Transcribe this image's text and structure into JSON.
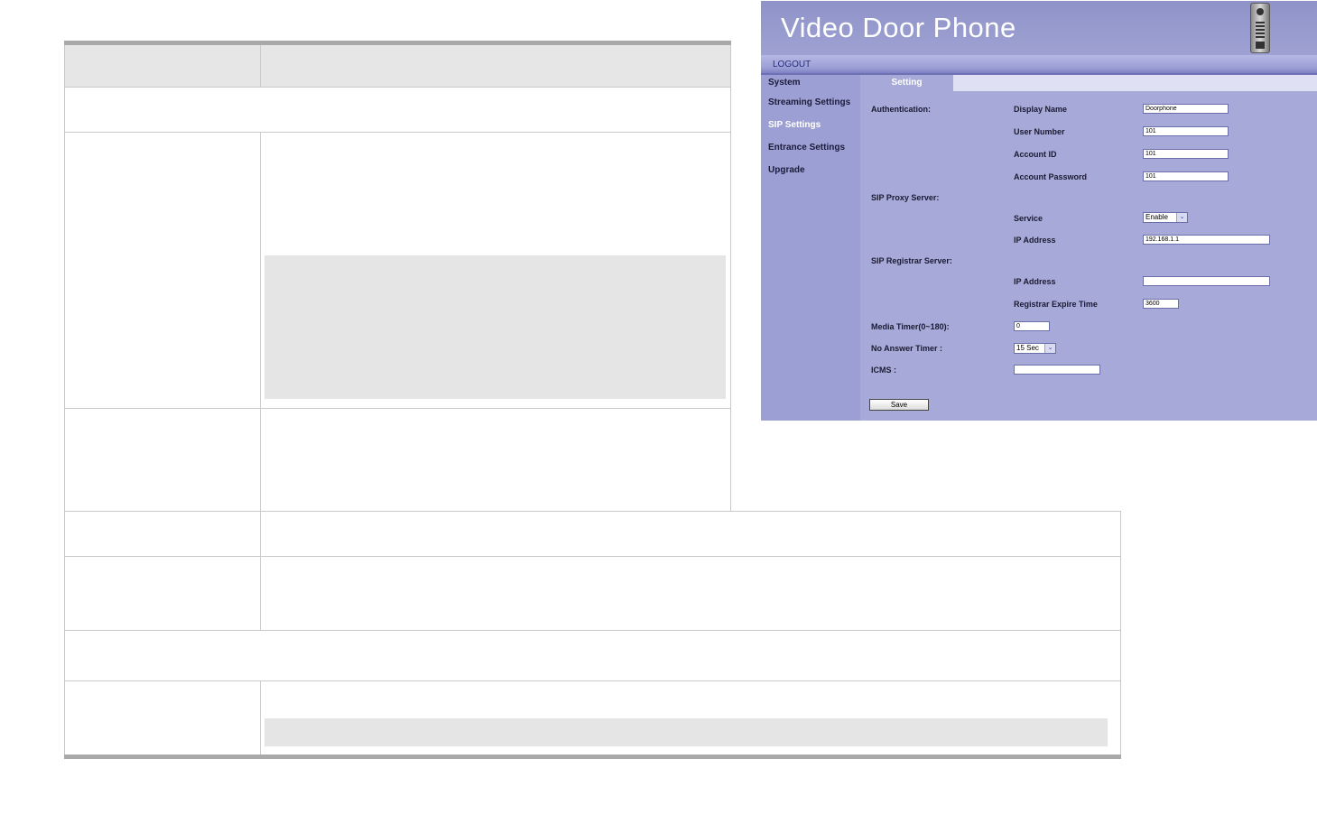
{
  "panel": {
    "title": "Video Door Phone",
    "logout_label": "LOGOUT",
    "sidebar": [
      {
        "label": "System",
        "active": false
      },
      {
        "label": "Streaming Settings",
        "active": false
      },
      {
        "label": "SIP Settings",
        "active": true
      },
      {
        "label": "Entrance Settings",
        "active": false
      },
      {
        "label": "Upgrade",
        "active": false
      }
    ],
    "tab_label": "Setting",
    "authentication": {
      "section_label": "Authentication:",
      "display_name_label": "Display Name",
      "display_name_value": "Doorphone",
      "user_number_label": "User Number",
      "user_number_value": "101",
      "account_id_label": "Account ID",
      "account_id_value": "101",
      "account_password_label": "Account Password",
      "account_password_value": "101"
    },
    "proxy": {
      "section_label": "SIP Proxy Server:",
      "service_label": "Service",
      "service_value": "Enable",
      "ip_label": "IP Address",
      "ip_value": "192.168.1.1"
    },
    "registrar": {
      "section_label": "SIP Registrar Server:",
      "ip_label": "IP Address",
      "ip_value": "",
      "expire_label": "Registrar Expire Time",
      "expire_value": "3600"
    },
    "media_timer_label": "Media Timer(0~180):",
    "media_timer_value": "0",
    "no_answer_label": "No Answer Timer :",
    "no_answer_value": "15 Sec",
    "icms_label": "ICMS :",
    "icms_value": "",
    "save_label": "Save",
    "colors": {
      "panel_bg": "#a7a9d8",
      "banner": "#9ea1d2",
      "logout_text": "#2a2d7a"
    }
  }
}
